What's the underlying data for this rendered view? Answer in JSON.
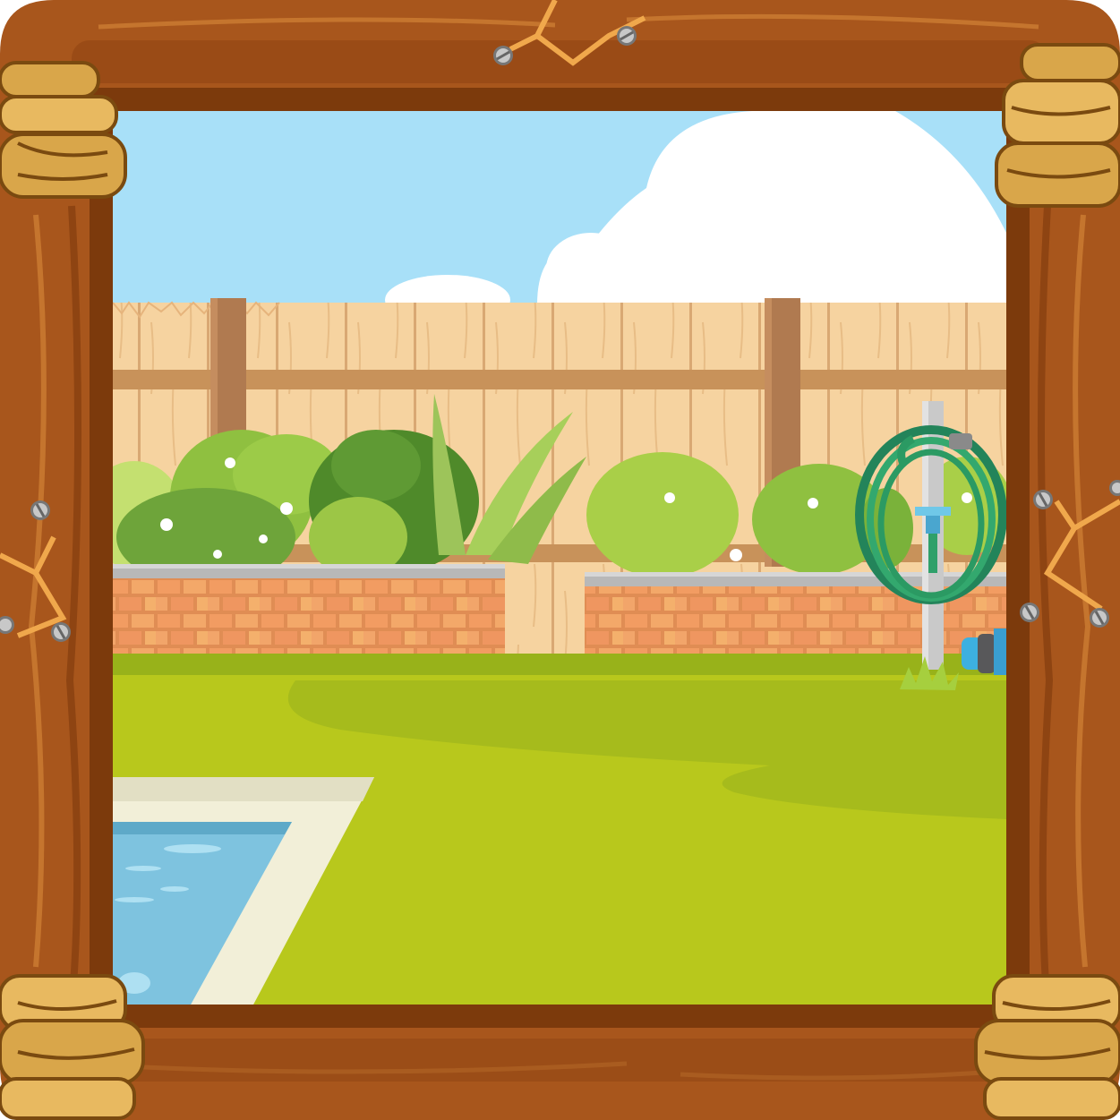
{
  "scene": {
    "type": "cartoon-backyard-escape-room-view",
    "frame": {
      "material": "wood",
      "corner_decoration": "rope-wrap",
      "fastener": "screw"
    },
    "elements": [
      "sky",
      "clouds",
      "wooden-fence",
      "bushes",
      "brick-walls",
      "lawn",
      "swimming-pool",
      "garden-hose-reel",
      "hose-nozzle"
    ]
  },
  "colors": {
    "sky": "#a8e0f8",
    "cloud": "#ffffff",
    "fence_plank": "#f6d3a0",
    "fence_post": "#b07a50",
    "bush_light": "#a9cf48",
    "bush_dark": "#6a9a38",
    "brick": "#f09e62",
    "wall_cap": "#b8b8b8",
    "lawn": "#b8c81c",
    "lawn_shadow": "#98b21a",
    "pool_water": "#7ec3df",
    "pool_edge": "#f2efd8",
    "hose": "#2fa06a",
    "frame_wood": "#a8561c",
    "frame_dark": "#7c3a0c",
    "rope": "#d9a64a"
  }
}
